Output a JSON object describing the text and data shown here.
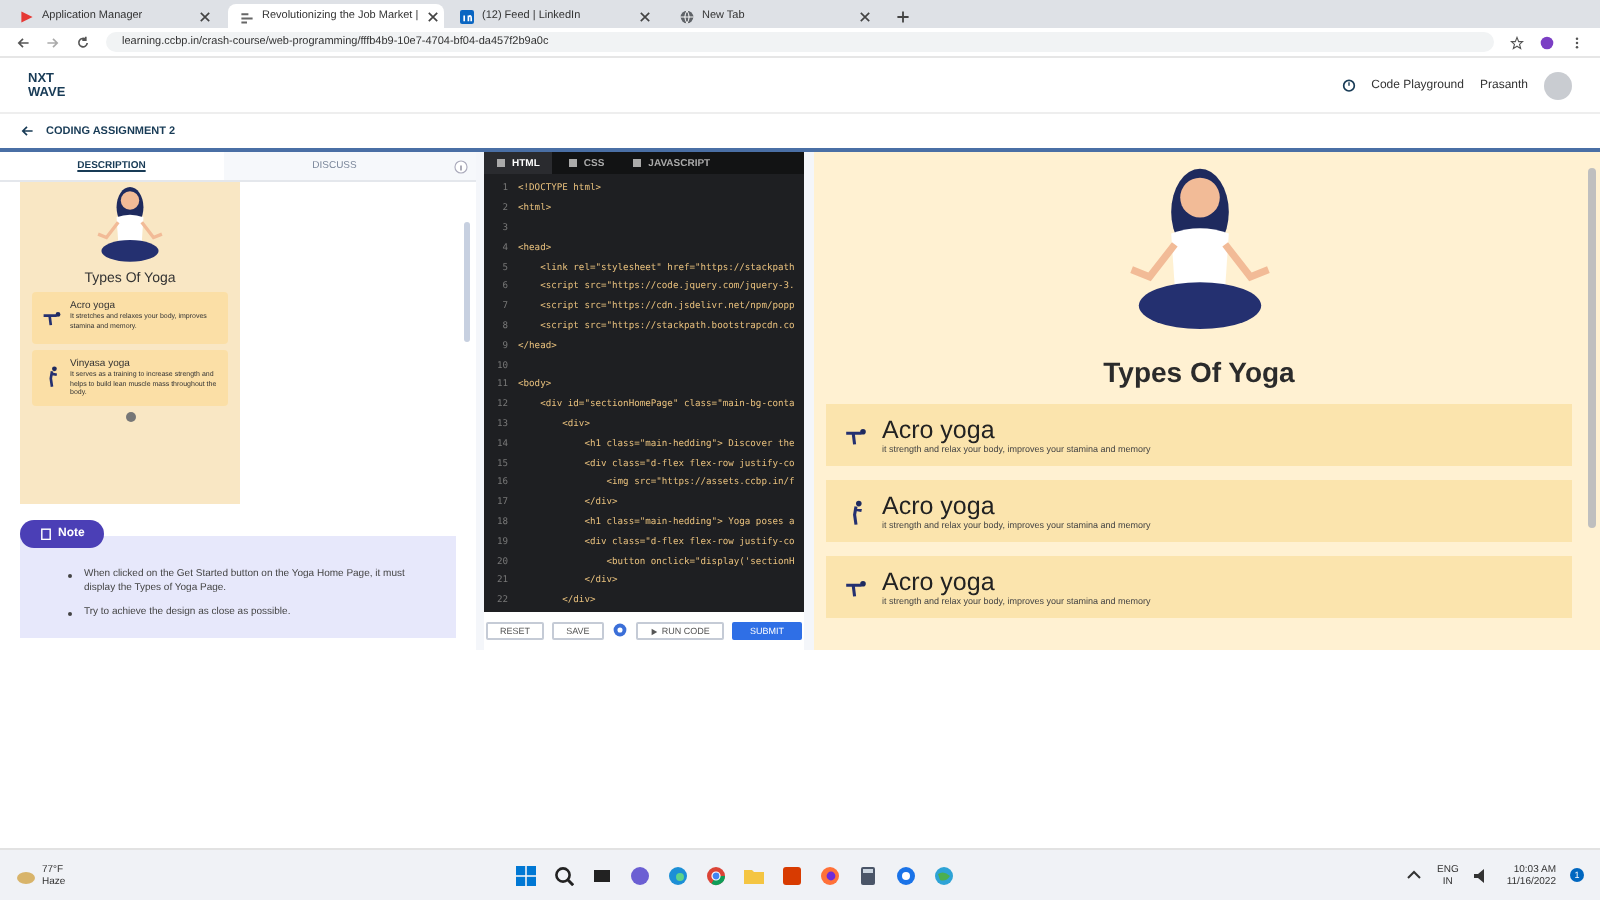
{
  "browser": {
    "tabs": [
      {
        "title": "Application Manager",
        "kind": "play",
        "selected": false
      },
      {
        "title": "Revolutionizing the Job Market |",
        "kind": "page",
        "selected": true
      },
      {
        "title": "(12) Feed | LinkedIn",
        "kind": "in",
        "selected": false
      },
      {
        "title": "New Tab",
        "kind": "globe",
        "selected": false
      }
    ],
    "url": "learning.ccbp.in/crash-course/web-programming/fffb4b9-10e7-4704-bf04-da457f2b9a0c"
  },
  "header": {
    "logo": [
      "NXT",
      "WAVE"
    ],
    "playground": "Code Playground",
    "user": "Prasanth"
  },
  "breadcrumb": "CODING ASSIGNMENT 2",
  "description": {
    "tabs": [
      {
        "label": "DESCRIPTION",
        "selected": true
      },
      {
        "label": "DISCUSS",
        "selected": false
      }
    ],
    "preview": {
      "title": "Types Of Yoga",
      "cards": [
        {
          "title": "Acro yoga",
          "text": "It stretches and relaxes your body, improves stamina and memory."
        },
        {
          "title": "Vinyasa yoga",
          "text": "It serves as a training to increase strength and helps to build lean muscle mass throughout the body."
        }
      ]
    },
    "note": {
      "label": "Note",
      "bullets": [
        "When clicked on the Get Started button on the Yoga Home Page, it must display the Types of Yoga Page.",
        "Try to achieve the design as close as possible."
      ]
    }
  },
  "editor": {
    "tabs": [
      {
        "label": "HTML",
        "selected": true
      },
      {
        "label": "CSS",
        "selected": false
      },
      {
        "label": "JAVASCRIPT",
        "selected": false
      }
    ],
    "lines": [
      {
        "number": "1",
        "text": "<!DOCTYPE html>"
      },
      {
        "number": "2",
        "text": "<html>"
      },
      {
        "number": "3"
      },
      {
        "number": "4",
        "text": "<head>"
      },
      {
        "number": "5",
        "text": "    <link rel=\"stylesheet\" href=\"https://stackpath"
      },
      {
        "number": "6",
        "text": "    <script src=\"https://code.jquery.com/jquery-3."
      },
      {
        "number": "7",
        "text": "    <script src=\"https://cdn.jsdelivr.net/npm/popp"
      },
      {
        "number": "8",
        "text": "    <script src=\"https://stackpath.bootstrapcdn.co"
      },
      {
        "number": "9",
        "text": "</head>"
      },
      {
        "number": "10"
      },
      {
        "number": "11",
        "text": "<body>"
      },
      {
        "number": "12",
        "text": "    <div id=\"sectionHomePage\" class=\"main-bg-conta"
      },
      {
        "number": "13",
        "text": "        <div>"
      },
      {
        "number": "14",
        "text": "            <h1 class=\"main-hedding\"> Discover the"
      },
      {
        "number": "15",
        "text": "            <div class=\"d-flex flex-row justify-co"
      },
      {
        "number": "16",
        "text": "                <img src=\"https://assets.ccbp.in/f"
      },
      {
        "number": "17",
        "text": "            </div>"
      },
      {
        "number": "18",
        "text": "            <h1 class=\"main-hedding\"> Yoga poses a"
      },
      {
        "number": "19",
        "text": "            <div class=\"d-flex flex-row justify-co"
      },
      {
        "number": "20",
        "text": "                <button onclick=\"display('sectionH"
      },
      {
        "number": "21",
        "text": "            </div>"
      },
      {
        "number": "22",
        "text": "        </div>"
      }
    ],
    "buttons": [
      {
        "kind": "outline",
        "label": "RESET"
      },
      {
        "kind": "outline",
        "label": "SAVE"
      },
      {
        "kind": "gear"
      },
      {
        "kind": "run",
        "label": "RUN CODE"
      },
      {
        "kind": "primary",
        "label": "SUBMIT"
      }
    ]
  },
  "preview": {
    "title": "Types Of Yoga",
    "cards": [
      {
        "title": "Acro yoga",
        "text": "it strength and relax your body, improves your stamina and memory"
      },
      {
        "title": "Acro yoga",
        "text": "it strength and relax your body, improves your stamina and memory"
      },
      {
        "title": "Acro yoga",
        "text": "it strength and relax your body, improves your stamina and memory"
      }
    ]
  },
  "taskbar": {
    "temperature": "77°F",
    "weather": "Haze",
    "language": "ENG",
    "region": "IN",
    "time": "10:03 AM",
    "date": "11/16/2022",
    "badge": "1"
  }
}
